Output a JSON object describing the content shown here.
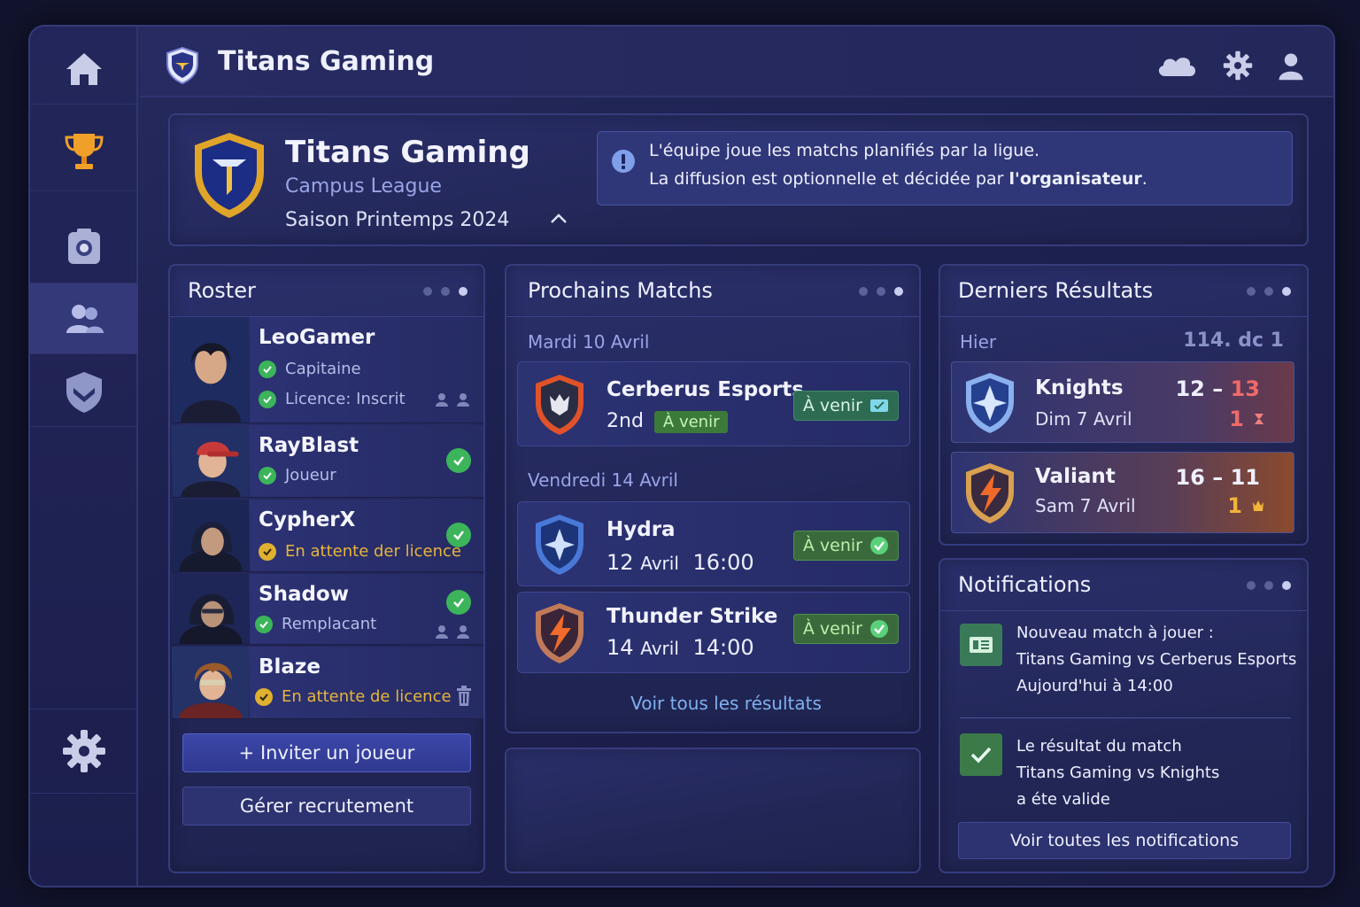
{
  "app": {
    "title": "Titans Gaming"
  },
  "team": {
    "name": "Titans Gaming",
    "league": "Campus League",
    "season": "Saison Printemps 2024"
  },
  "info": {
    "line1": "L'équipe joue les matchs planifiés par la ligue.",
    "line2_prefix": "La diffusion est optionnelle et décidée par ",
    "line2_bold": "l'organisateur",
    "line2_suffix": "."
  },
  "roster": {
    "title": "Roster",
    "players": [
      {
        "name": "LeoGamer",
        "line1": "Capitaine",
        "line2": "Licence: Inscrit"
      },
      {
        "name": "RayBlast",
        "line1": "Joueur"
      },
      {
        "name": "CypherX",
        "line1": "En attente der licence"
      },
      {
        "name": "Shadow",
        "line1": "Remplacant"
      },
      {
        "name": "Blaze",
        "line1": "En attente de licence"
      }
    ],
    "invite_button": "+ Inviter un joueur",
    "manage_button": "Gérer recrutement"
  },
  "matches": {
    "title": "Prochains Matchs",
    "groups": [
      {
        "date": "Mardi 10 Avril"
      },
      {
        "date": "Vendredi 14 Avril"
      }
    ],
    "items": [
      {
        "opponent": "Cerberus Esports",
        "rank": "2nd",
        "tag": "À venir",
        "status": "À venir"
      },
      {
        "opponent": "Hydra",
        "day": "12",
        "month": "Avril",
        "time": "16:00",
        "status": "À venir"
      },
      {
        "opponent": "Thunder Strike",
        "day": "14",
        "month": "Avril",
        "time": "14:00",
        "status": "À venir"
      }
    ],
    "link": "Voir tous les résultats"
  },
  "results": {
    "title": "Derniers Résultats",
    "group_label": "Hier",
    "group_meta": "114. dc 1",
    "items": [
      {
        "team": "Knights",
        "date": "Dim  7 Avril",
        "score_a": "12",
        "score_sep": "–",
        "score_b": "13",
        "rank": "1",
        "outcome_color": "#f06a6a"
      },
      {
        "team": "Valiant",
        "date": "Sam 7 Avril",
        "score_a": "16",
        "score_sep": "–",
        "score_b": "11",
        "rank": "1",
        "outcome_color": "#f2b43a"
      }
    ]
  },
  "notifications": {
    "title": "Notifications",
    "items": [
      {
        "line1": "Nouveau match à jouer :",
        "line2": "Titans Gaming vs Cerberus Esports",
        "line3": "Aujourd'hui à 14:00"
      },
      {
        "line1": "Le résultat du match",
        "line2": "Titans Gaming vs Knights",
        "line3": "a éte valide"
      }
    ],
    "link": "Voir toutes les notifications"
  },
  "colors": {
    "accent": "#3c47a8",
    "success": "#3bb45a",
    "warning": "#e0b030",
    "loss": "#f06a6a"
  },
  "icons": {
    "sidebar": [
      "home-icon",
      "trophy-icon",
      "camera-icon",
      "users-icon",
      "shield-icon",
      "gear-icon"
    ],
    "topbar": [
      "cloud-icon",
      "gear-icon",
      "user-icon"
    ]
  }
}
